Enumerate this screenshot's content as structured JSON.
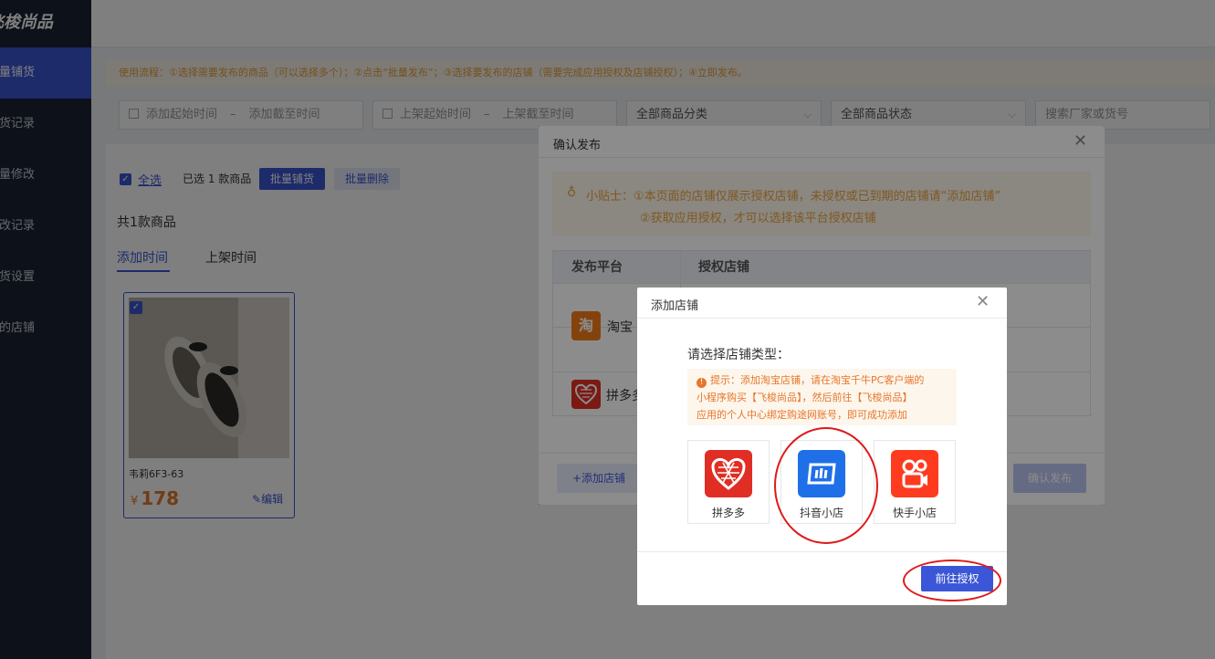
{
  "app": {
    "logo_text": "飞梭尚品"
  },
  "sidebar": {
    "items": [
      {
        "label": "批量铺货",
        "active": true
      },
      {
        "label": "铺货记录"
      },
      {
        "label": "批量修改"
      },
      {
        "label": "修改记录"
      },
      {
        "label": "铺货设置"
      },
      {
        "label": "我的店铺"
      }
    ]
  },
  "notice": "使用流程：①选择需要发布的商品（可以选择多个）；②点击“批量发布”；③选择要发布的店铺（需要完成应用授权及店铺授权）；④立即发布。",
  "filters": {
    "add_start": "添加起始时间",
    "add_end": "添加截至时间",
    "shelf_start": "上架起始时间",
    "shelf_end": "上架截至时间",
    "dash": "–",
    "category": "全部商品分类",
    "status": "全部商品状态",
    "search_placeholder": "搜索厂家或货号"
  },
  "toolbar": {
    "select_all": "全选",
    "selected_text": "已选 1 款商品",
    "batch_list": "批量铺货",
    "batch_delete": "批量删除"
  },
  "total_text": "共1款商品",
  "tabs": [
    {
      "label": "添加时间",
      "active": true
    },
    {
      "label": "上架时间"
    }
  ],
  "product": {
    "name": "韦莉6F3-63",
    "currency": "¥",
    "price": "178",
    "edit": "编辑"
  },
  "confirm_dialog": {
    "title": "确认发布",
    "tip_prefix": "小贴士：",
    "tip_line1": "①本页面的店铺仅展示授权店铺，未授权或已到期的店铺请“添加店铺”",
    "tip_line2": "②获取应用授权，才可以选择该平台授权店铺",
    "col_platform": "发布平台",
    "col_shop": "授权店铺",
    "platforms": [
      {
        "name": "淘宝",
        "icon": "taobao-icon",
        "glyph": "淘",
        "color": "#f07a18"
      },
      {
        "name": "拼多多",
        "icon": "pinduoduo-icon",
        "color": "#e02e24"
      }
    ],
    "add_shop": "添加店铺",
    "confirm": "确认发布"
  },
  "add_shop_dialog": {
    "title": "添加店铺",
    "choose_label": "请选择店铺类型：",
    "hint_line1": "提示：添加淘宝店铺，请在淘宝千牛PC客户端的",
    "hint_line2": "小程序购买【飞梭尚品】，然后前往【飞梭尚品】",
    "hint_line3": "应用的个人中心绑定购途网账号，即可成功添加",
    "options": [
      {
        "label": "拼多多",
        "icon": "pinduoduo-logo-icon",
        "color": "#e02e24"
      },
      {
        "label": "抖音小店",
        "icon": "douyin-shop-logo-icon",
        "color": "#1f6fe8"
      },
      {
        "label": "快手小店",
        "icon": "kuaishou-shop-logo-icon",
        "color": "#fe3b1f"
      }
    ],
    "go_authorize": "前往授权"
  },
  "colors": {
    "accent": "#3b56d6",
    "annotation": "#e01818"
  }
}
